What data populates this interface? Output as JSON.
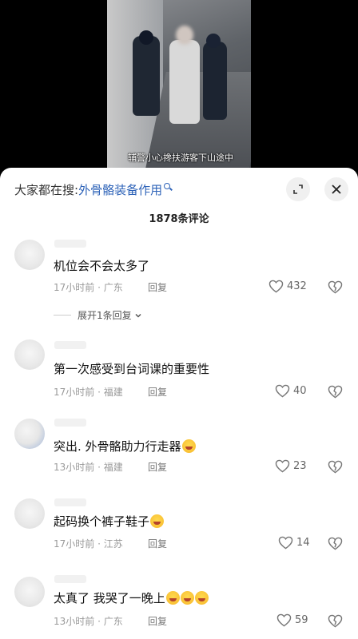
{
  "video": {
    "caption": "辅警小心搀扶游客下山途中"
  },
  "search": {
    "prefix": "大家都在搜:",
    "term": "外骨骼装备作用"
  },
  "comment_count": "1878条评论",
  "comments": [
    {
      "text": "机位会不会太多了",
      "meta": "17小时前 · 广东",
      "reply": "回复",
      "likes": "432",
      "emoji_count": 0
    },
    {
      "text": "第一次感受到台词课的重要性",
      "meta": "17小时前 · 福建",
      "reply": "回复",
      "likes": "40",
      "emoji_count": 0
    },
    {
      "text": "突出. 外骨骼助力行走器",
      "meta": "13小时前 · 福建",
      "reply": "回复",
      "likes": "23",
      "emoji_count": 1
    },
    {
      "text": "起码换个裤子鞋子",
      "meta": "17小时前 · 江苏",
      "reply": "回复",
      "likes": "14",
      "emoji_count": 1
    },
    {
      "text": "太真了 我哭了一晚上",
      "meta": "13小时前 · 广东",
      "reply": "回复",
      "likes": "59",
      "emoji_count": 3
    }
  ],
  "expand_replies": "展开1条回复",
  "icons": {
    "expand": "expand-icon",
    "close": "close-icon",
    "like": "heart-icon",
    "dislike": "broken-heart-icon",
    "search": "search-icon"
  }
}
